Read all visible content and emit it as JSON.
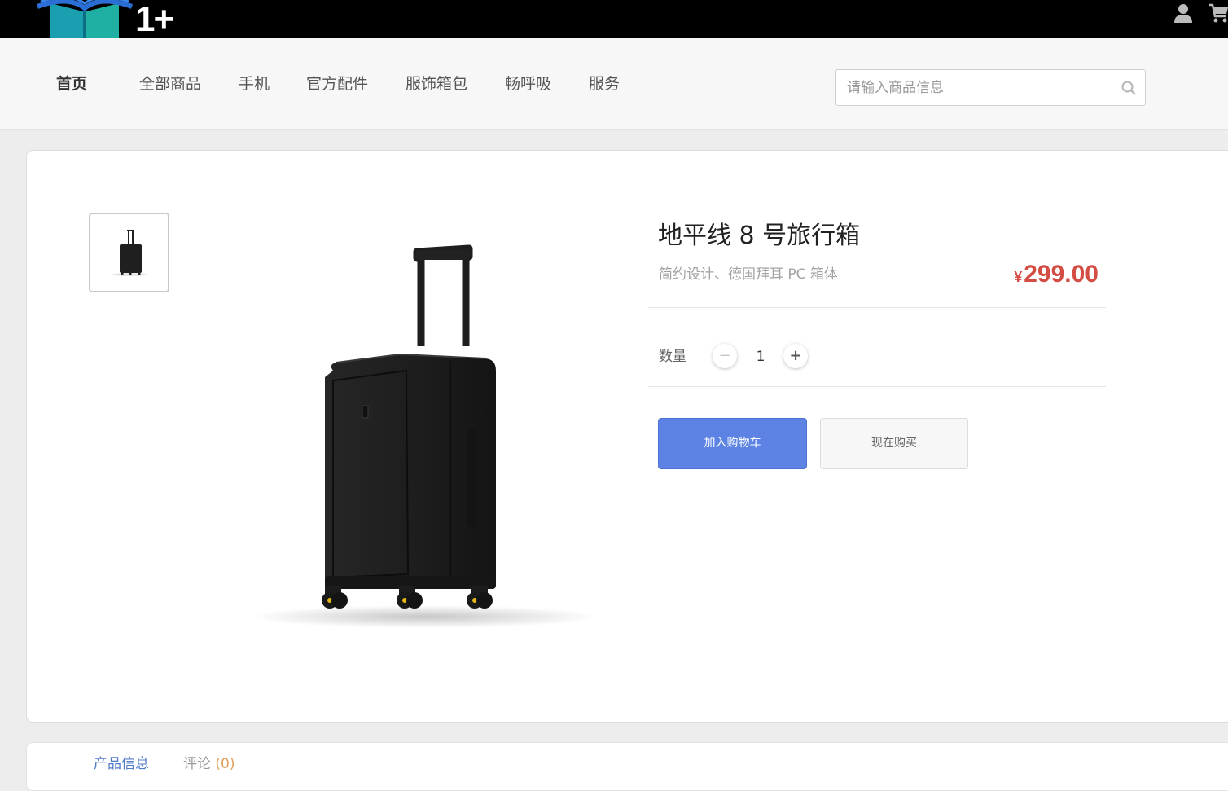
{
  "header": {
    "logo_text": "1+",
    "user_icon": "user-icon",
    "cart_icon": "cart-icon"
  },
  "nav": {
    "items": [
      {
        "label": "首页",
        "active": true
      },
      {
        "label": "全部商品"
      },
      {
        "label": "手机"
      },
      {
        "label": "官方配件"
      },
      {
        "label": "服饰箱包"
      },
      {
        "label": "畅呼吸"
      },
      {
        "label": "服务"
      }
    ],
    "search": {
      "placeholder": "请输入商品信息",
      "icon": "search-icon"
    }
  },
  "product": {
    "title": "地平线 8 号旅行箱",
    "subtitle": "简约设计、德国拜耳 PC 箱体",
    "currency": "¥",
    "price": "299.00",
    "quantity_label": "数量",
    "quantity": "1",
    "minus_label": "−",
    "plus_label": "+",
    "add_to_cart_label": "加入购物车",
    "buy_now_label": "现在购买"
  },
  "tabs": [
    {
      "label": "产品信息",
      "active": true
    },
    {
      "label": "评论",
      "count": "(0)"
    }
  ],
  "colors": {
    "accent": "#5c83e3",
    "price": "#d44d44",
    "topbar": "#000000"
  }
}
